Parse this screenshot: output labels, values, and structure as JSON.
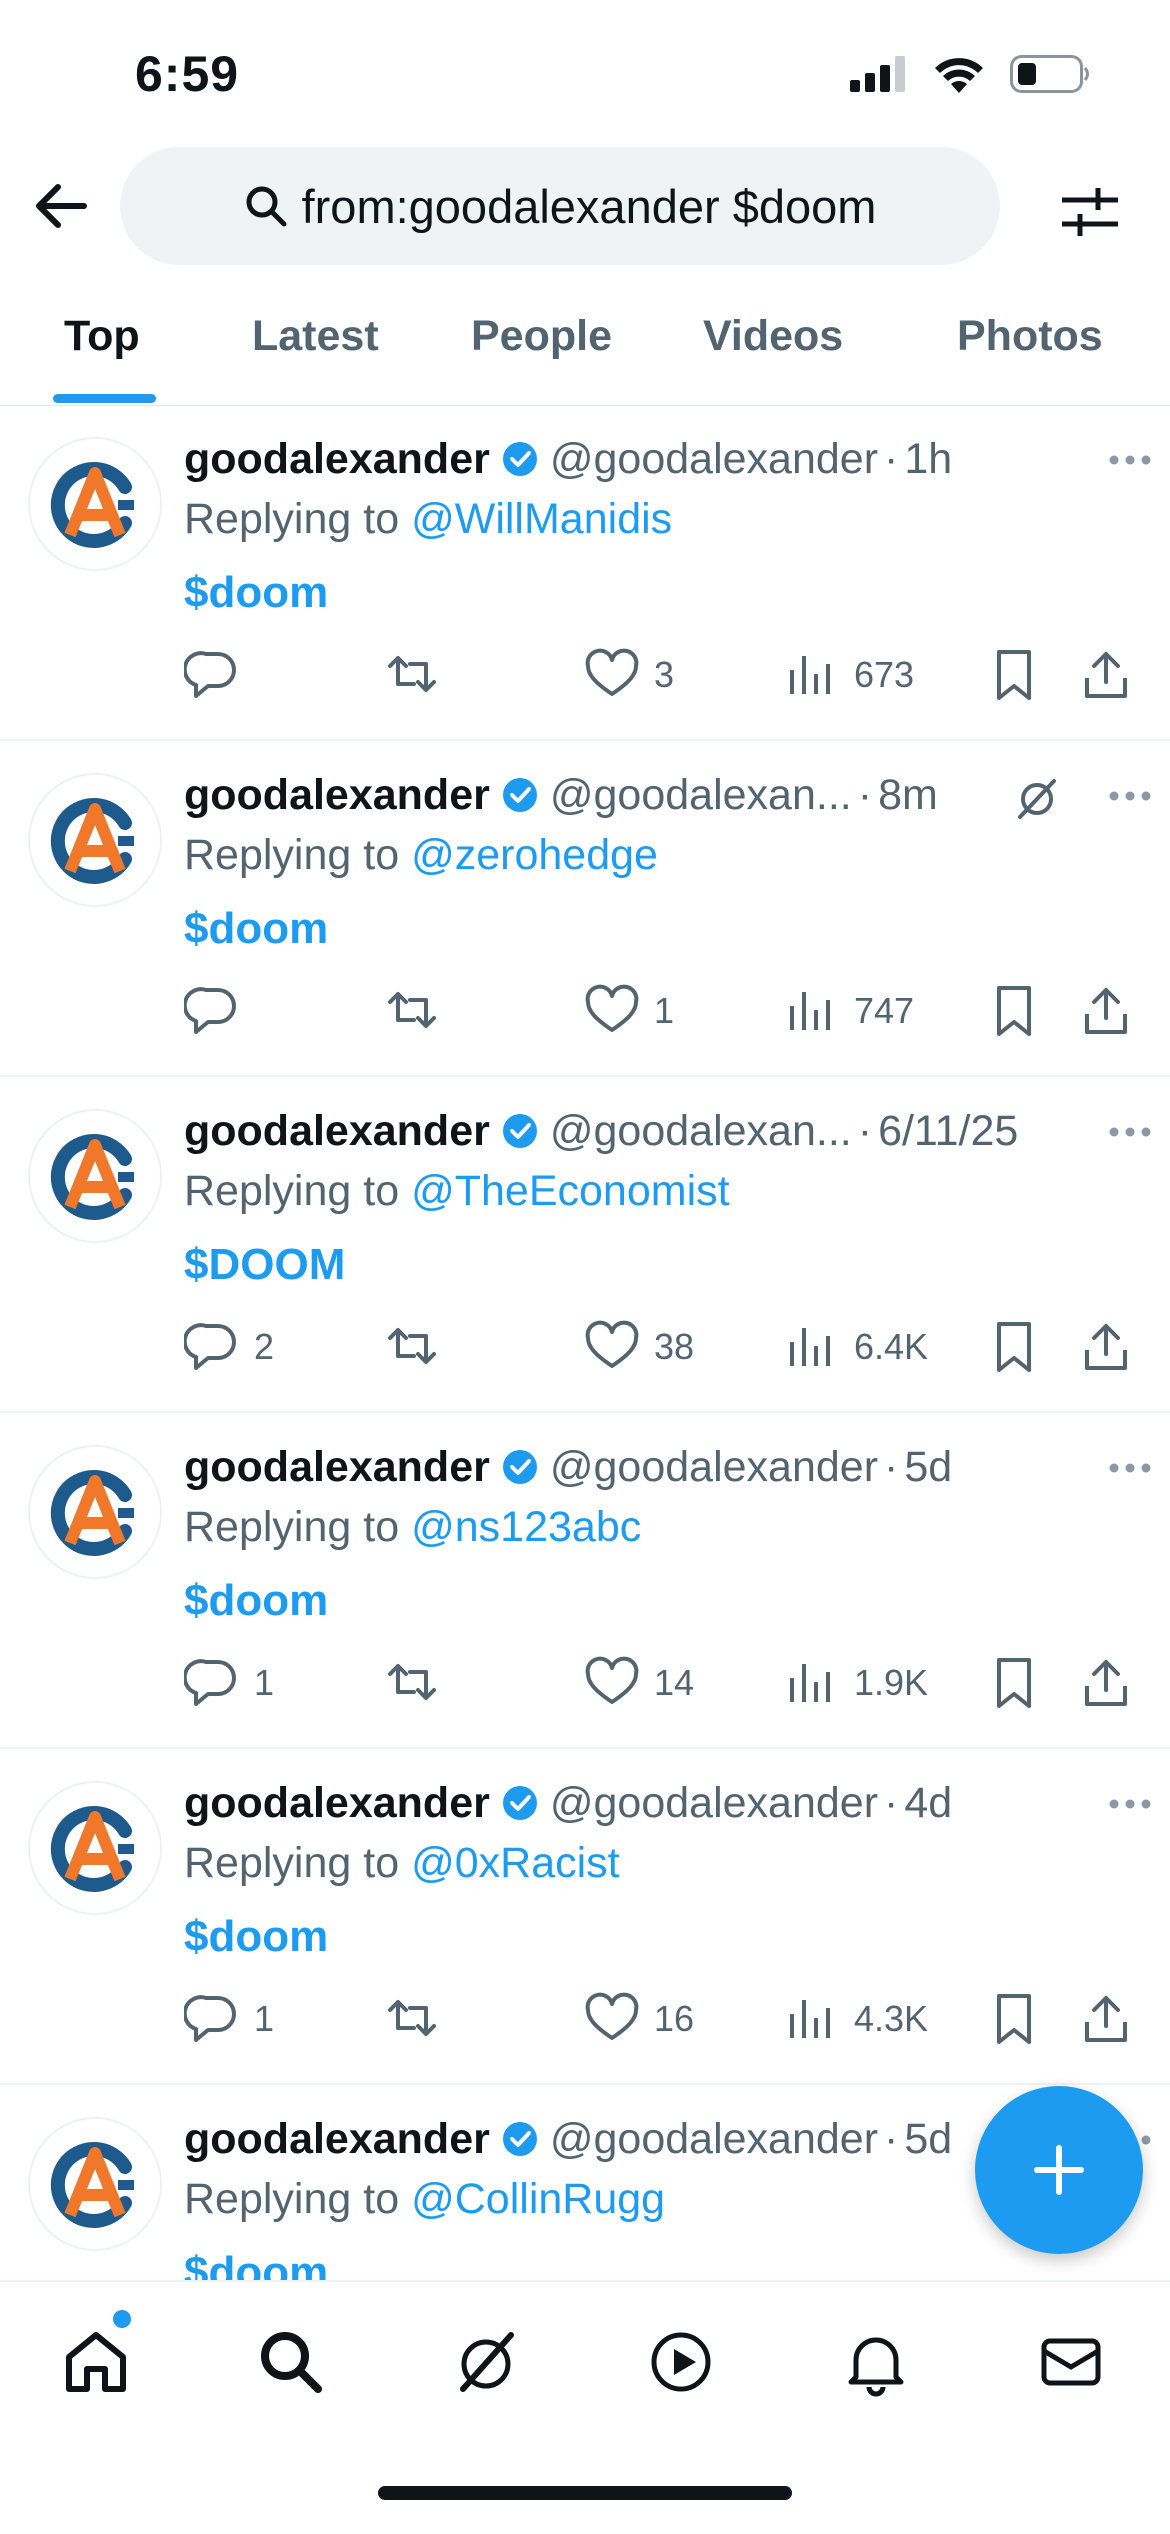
{
  "status_bar": {
    "time": "6:59"
  },
  "search": {
    "query": "from:goodalexander $doom"
  },
  "tabs": [
    {
      "label": "Top",
      "active": true
    },
    {
      "label": "Latest",
      "active": false
    },
    {
      "label": "People",
      "active": false
    },
    {
      "label": "Videos",
      "active": false
    },
    {
      "label": "Photos",
      "active": false
    }
  ],
  "reply_prefix": "Replying to",
  "tweets": [
    {
      "name": "goodalexander",
      "handle": "@goodalexander",
      "time": "1h",
      "reply_to": "@WillManidis",
      "text": "$doom",
      "replies": "",
      "retweets": "",
      "likes": "3",
      "views": "673",
      "grok": false
    },
    {
      "name": "goodalexander",
      "handle": "@goodalexan...",
      "time": "8m",
      "reply_to": "@zerohedge",
      "text": "$doom",
      "replies": "",
      "retweets": "",
      "likes": "1",
      "views": "747",
      "grok": true
    },
    {
      "name": "goodalexander",
      "handle": "@goodalexan...",
      "time": "6/11/25",
      "reply_to": "@TheEconomist",
      "text": "$DOOM",
      "replies": "2",
      "retweets": "",
      "likes": "38",
      "views": "6.4K",
      "grok": false
    },
    {
      "name": "goodalexander",
      "handle": "@goodalexander",
      "time": "5d",
      "reply_to": "@ns123abc",
      "text": "$doom",
      "replies": "1",
      "retweets": "",
      "likes": "14",
      "views": "1.9K",
      "grok": false
    },
    {
      "name": "goodalexander",
      "handle": "@goodalexander",
      "time": "4d",
      "reply_to": "@0xRacist",
      "text": "$doom",
      "replies": "1",
      "retweets": "",
      "likes": "16",
      "views": "4.3K",
      "grok": false
    },
    {
      "name": "goodalexander",
      "handle": "@goodalexander",
      "time": "5d",
      "reply_to": "@CollinRugg",
      "text": "$doom",
      "replies": "",
      "retweets": "",
      "likes": "",
      "views": "",
      "grok": false
    }
  ],
  "colors": {
    "accent": "#1d9bf0",
    "secondary_text": "#536471",
    "primary_text": "#0f1419"
  }
}
